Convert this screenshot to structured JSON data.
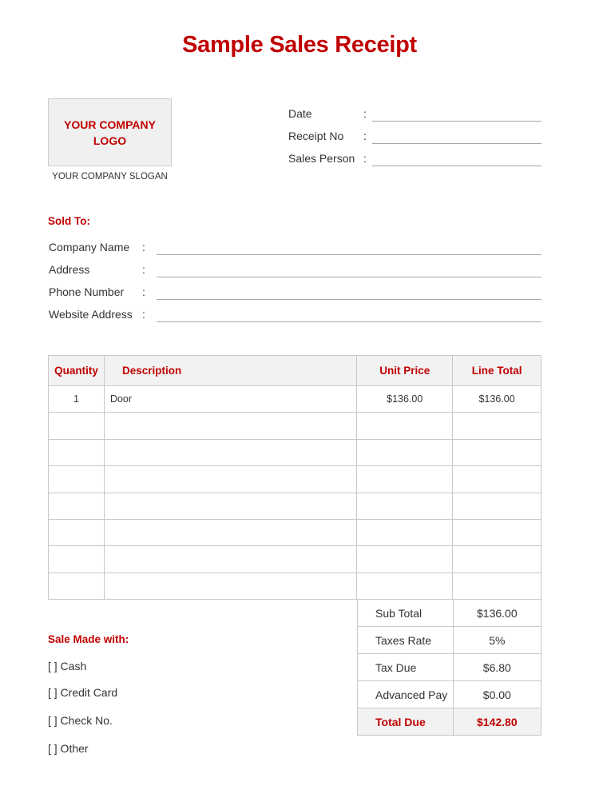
{
  "title": "Sample Sales Receipt",
  "company": {
    "logo_text": "YOUR COMPANY LOGO",
    "slogan": "YOUR COMPANY SLOGAN"
  },
  "receipt_info": [
    {
      "label": "Date",
      "value": ""
    },
    {
      "label": "Receipt No",
      "value": ""
    },
    {
      "label": "Sales Person",
      "value": ""
    }
  ],
  "sold_to": {
    "heading": "Sold To:",
    "fields": [
      {
        "label": "Company Name",
        "value": ""
      },
      {
        "label": "Address",
        "value": ""
      },
      {
        "label": "Phone Number",
        "value": ""
      },
      {
        "label": "Website Address",
        "value": ""
      }
    ]
  },
  "colon": ":",
  "items_table": {
    "headers": [
      "Quantity",
      "Description",
      "Unit Price",
      "Line Total"
    ],
    "rows": [
      [
        "1",
        "Door",
        "$136.00",
        "$136.00"
      ],
      [
        "",
        "",
        "",
        ""
      ],
      [
        "",
        "",
        "",
        ""
      ],
      [
        "",
        "",
        "",
        ""
      ],
      [
        "",
        "",
        "",
        ""
      ],
      [
        "",
        "",
        "",
        ""
      ],
      [
        "",
        "",
        "",
        ""
      ],
      [
        "",
        "",
        "",
        ""
      ]
    ]
  },
  "summary": [
    {
      "label": "Sub Total",
      "value": "$136.00"
    },
    {
      "label": "Taxes Rate",
      "value": "5%"
    },
    {
      "label": "Tax Due",
      "value": "$6.80"
    },
    {
      "label": "Advanced Pay",
      "value": "$0.00"
    },
    {
      "label": "Total Due",
      "value": "$142.80"
    }
  ],
  "payment": {
    "heading": "Sale Made with:",
    "options": [
      "[ ] Cash",
      "[ ] Credit Card",
      "[ ] Check No.",
      "[ ] Other"
    ]
  },
  "colors": {
    "accent": "#c00000",
    "header_fill": "#f2f2f2",
    "border": "#c8c8c8"
  }
}
